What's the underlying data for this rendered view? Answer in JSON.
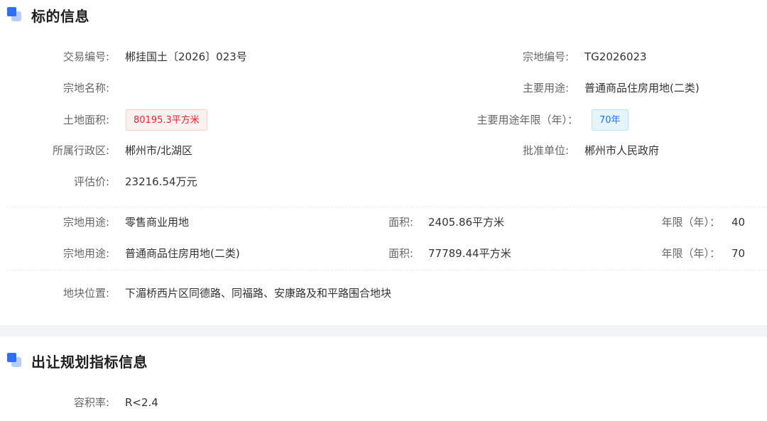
{
  "section1": {
    "title": "标的信息",
    "trade_no": {
      "label": "交易编号:",
      "value": "郴挂国土〔2026〕023号"
    },
    "parcel_no": {
      "label": "宗地编号:",
      "value": "TG2026023"
    },
    "parcel_name": {
      "label": "宗地名称:",
      "value": ""
    },
    "main_use": {
      "label": "主要用途:",
      "value": "普通商品住房用地(二类)"
    },
    "land_area": {
      "label": "土地面积:",
      "value": "80195.3平方米"
    },
    "main_use_years": {
      "label": "主要用途年限（年）：",
      "value": "70年"
    },
    "district": {
      "label": "所属行政区:",
      "value": "郴州市/北湖区"
    },
    "approver": {
      "label": "批准单位:",
      "value": "郴州市人民政府"
    },
    "valuation": {
      "label": "评估价:",
      "value": "23216.54万元"
    },
    "uses": [
      {
        "use_label": "宗地用途:",
        "use": "零售商业用地",
        "area_label": "面积:",
        "area": "2405.86平方米",
        "years_label": "年限（年）：",
        "years": "40"
      },
      {
        "use_label": "宗地用途:",
        "use": "普通商品住房用地(二类)",
        "area_label": "面积:",
        "area": "77789.44平方米",
        "years_label": "年限（年）：",
        "years": "70"
      }
    ],
    "location": {
      "label": "地块位置:",
      "value": "下湄桥西片区同德路、同福路、安康路及和平路围合地块"
    }
  },
  "section2": {
    "title": "出让规划指标信息",
    "plot_ratio": {
      "label": "容积率:",
      "value": "R<2.4"
    }
  }
}
